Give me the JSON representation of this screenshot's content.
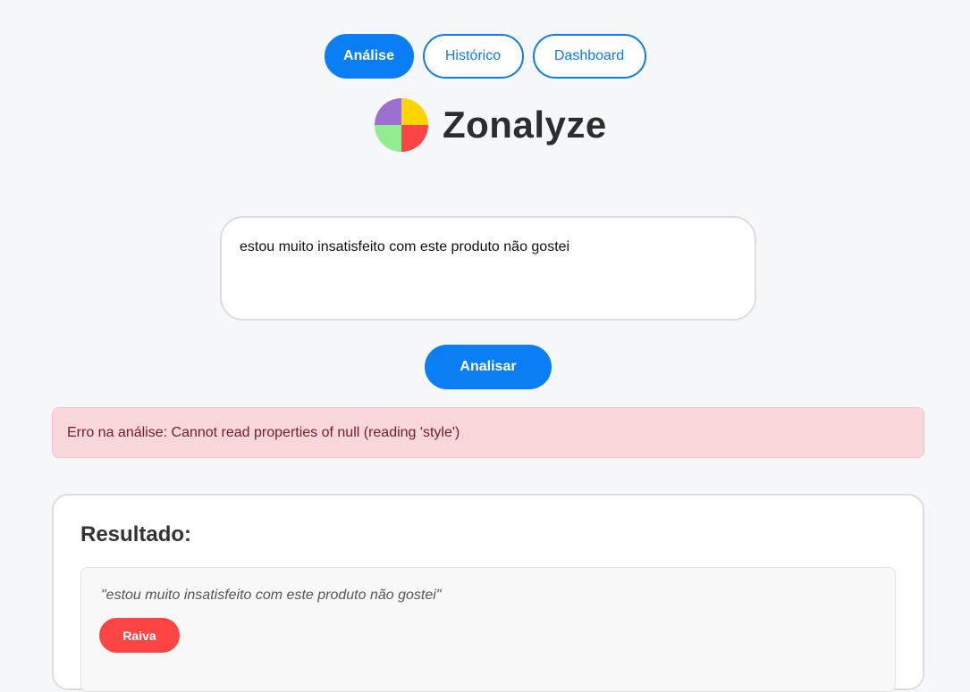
{
  "nav": {
    "tabs": [
      {
        "label": "Análise",
        "active": true
      },
      {
        "label": "Histórico",
        "active": false
      },
      {
        "label": "Dashboard",
        "active": false
      }
    ]
  },
  "brand": {
    "name": "Zonalyze",
    "logo_colors": [
      "#9b6fd0",
      "#ffd400",
      "#90ee90",
      "#ff4444"
    ]
  },
  "input": {
    "value": "estou muito insatisfeito com este produto não gostei"
  },
  "actions": {
    "analyze_label": "Analisar"
  },
  "error": {
    "message": "Erro na análise: Cannot read properties of null (reading 'style')"
  },
  "result": {
    "title": "Resultado:",
    "items": [
      {
        "quote": "\"estou muito insatisfeito com este produto não gostei\"",
        "emotion": "Raiva",
        "emotion_color": "#ff4444"
      }
    ]
  },
  "colors": {
    "accent": "#0a7ff5",
    "error_bg": "#f8d7da",
    "error_text": "#721c24"
  }
}
